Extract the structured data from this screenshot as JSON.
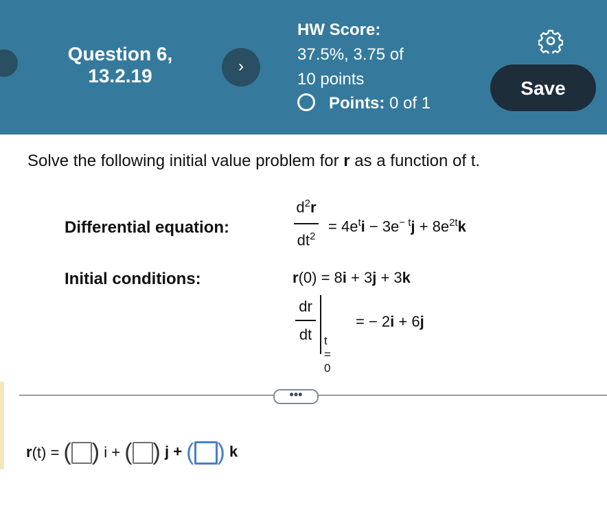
{
  "header": {
    "question_title_line1": "Question 6,",
    "question_title_line2": "13.2.19",
    "next_icon": "chevron-right-icon",
    "next_glyph": "›",
    "score_label": "HW Score:",
    "score_line2": "37.5%, 3.75 of",
    "score_line3": "10 points",
    "points_label": "Points:",
    "points_value": "0 of 1",
    "settings_icon": "gear-icon",
    "save_label": "Save",
    "colors": {
      "header_bg": "#357a9c",
      "button_bg": "#2a4e62",
      "save_bg": "#1d2d3a"
    }
  },
  "problem": {
    "prompt_pre": "Solve the following initial value problem for ",
    "prompt_var": "r",
    "prompt_post": " as a function of t.",
    "diffeq_label": "Differential equation:",
    "initcond_label": "Initial conditions:",
    "deq_num": "d",
    "deq_num_sup": "2",
    "deq_num_var": "r",
    "deq_den": "dt",
    "deq_den_sup": "2",
    "deq_rhs_1": "= 4e",
    "deq_rhs_1_sup": "t",
    "deq_rhs_i": "i",
    "deq_rhs_2": " − 3e",
    "deq_rhs_2_sup": "− t",
    "deq_rhs_j": "j",
    "deq_rhs_3": " + 8e",
    "deq_rhs_3_sup": "2t",
    "deq_rhs_k": "k",
    "ic1_r": "r",
    "ic1_rest": "(0) = 8",
    "ic1_i": "i",
    "ic1_plus1": " + 3",
    "ic1_j": "j",
    "ic1_plus2": " + 3",
    "ic1_k": "k",
    "ic2_num": "dr",
    "ic2_den": "dt",
    "ic2_eval": "t = 0",
    "ic2_rhs_1": "= − 2",
    "ic2_rhs_i": "i",
    "ic2_rhs_2": " + 6",
    "ic2_rhs_j": "j"
  },
  "divider": {
    "more_label": "•••"
  },
  "answer": {
    "lhs_r": "r",
    "lhs_rest": "(t) =",
    "i_label": "i +",
    "j_label": "j +",
    "k_label": "k"
  }
}
